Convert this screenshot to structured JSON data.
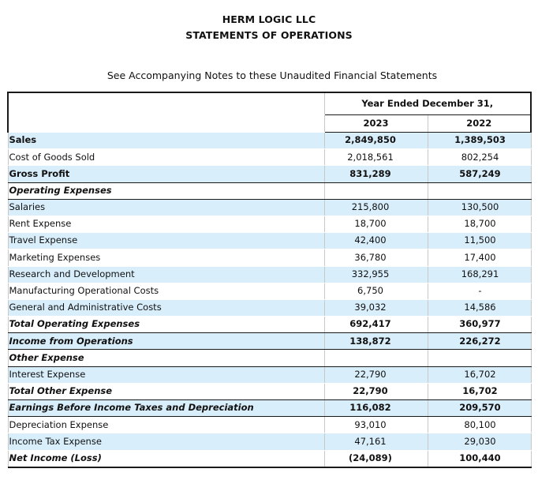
{
  "header": {
    "company": "HERM LOGIC LLC",
    "statement": "STATEMENTS OF OPERATIONS",
    "note": "See Accompanying Notes to these Unaudited Financial Statements"
  },
  "table": {
    "period_header": "Year Ended December 31,",
    "years": [
      "2023",
      "2022"
    ],
    "rows": [
      {
        "label": "Sales",
        "v2023": "2,849,850",
        "v2022": "1,389,503"
      },
      {
        "label": "Cost of Goods Sold",
        "v2023": "2,018,561",
        "v2022": "802,254"
      },
      {
        "label": "Gross Profit",
        "v2023": "831,289",
        "v2022": "587,249"
      },
      {
        "label": "Operating Expenses",
        "v2023": "",
        "v2022": ""
      },
      {
        "label": "Salaries",
        "v2023": "215,800",
        "v2022": "130,500"
      },
      {
        "label": "Rent Expense",
        "v2023": "18,700",
        "v2022": "18,700"
      },
      {
        "label": "Travel Expense",
        "v2023": "42,400",
        "v2022": "11,500"
      },
      {
        "label": "Marketing Expenses",
        "v2023": "36,780",
        "v2022": "17,400"
      },
      {
        "label": "Research and Development",
        "v2023": "332,955",
        "v2022": "168,291"
      },
      {
        "label": "Manufacturing Operational Costs",
        "v2023": "6,750",
        "v2022": "-"
      },
      {
        "label": "General and Administrative Costs",
        "v2023": "39,032",
        "v2022": "14,586"
      },
      {
        "label": "Total Operating Expenses",
        "v2023": "692,417",
        "v2022": "360,977"
      },
      {
        "label": "Income from Operations",
        "v2023": "138,872",
        "v2022": "226,272"
      },
      {
        "label": "Other Expense",
        "v2023": "",
        "v2022": ""
      },
      {
        "label": "Interest Expense",
        "v2023": "22,790",
        "v2022": "16,702"
      },
      {
        "label": "Total Other Expense",
        "v2023": "22,790",
        "v2022": "16,702"
      },
      {
        "label": "Earnings Before Income Taxes and Depreciation",
        "v2023": "116,082",
        "v2022": "209,570"
      },
      {
        "label": "Depreciation Expense",
        "v2023": "93,010",
        "v2022": "80,100"
      },
      {
        "label": "Income Tax Expense",
        "v2023": "47,161",
        "v2022": "29,030"
      },
      {
        "label": "Net Income (Loss)",
        "v2023": "(24,089)",
        "v2022": "100,440"
      }
    ]
  },
  "colors": {
    "highlight": "#d9eefb",
    "rule": "#1a1a1a"
  }
}
